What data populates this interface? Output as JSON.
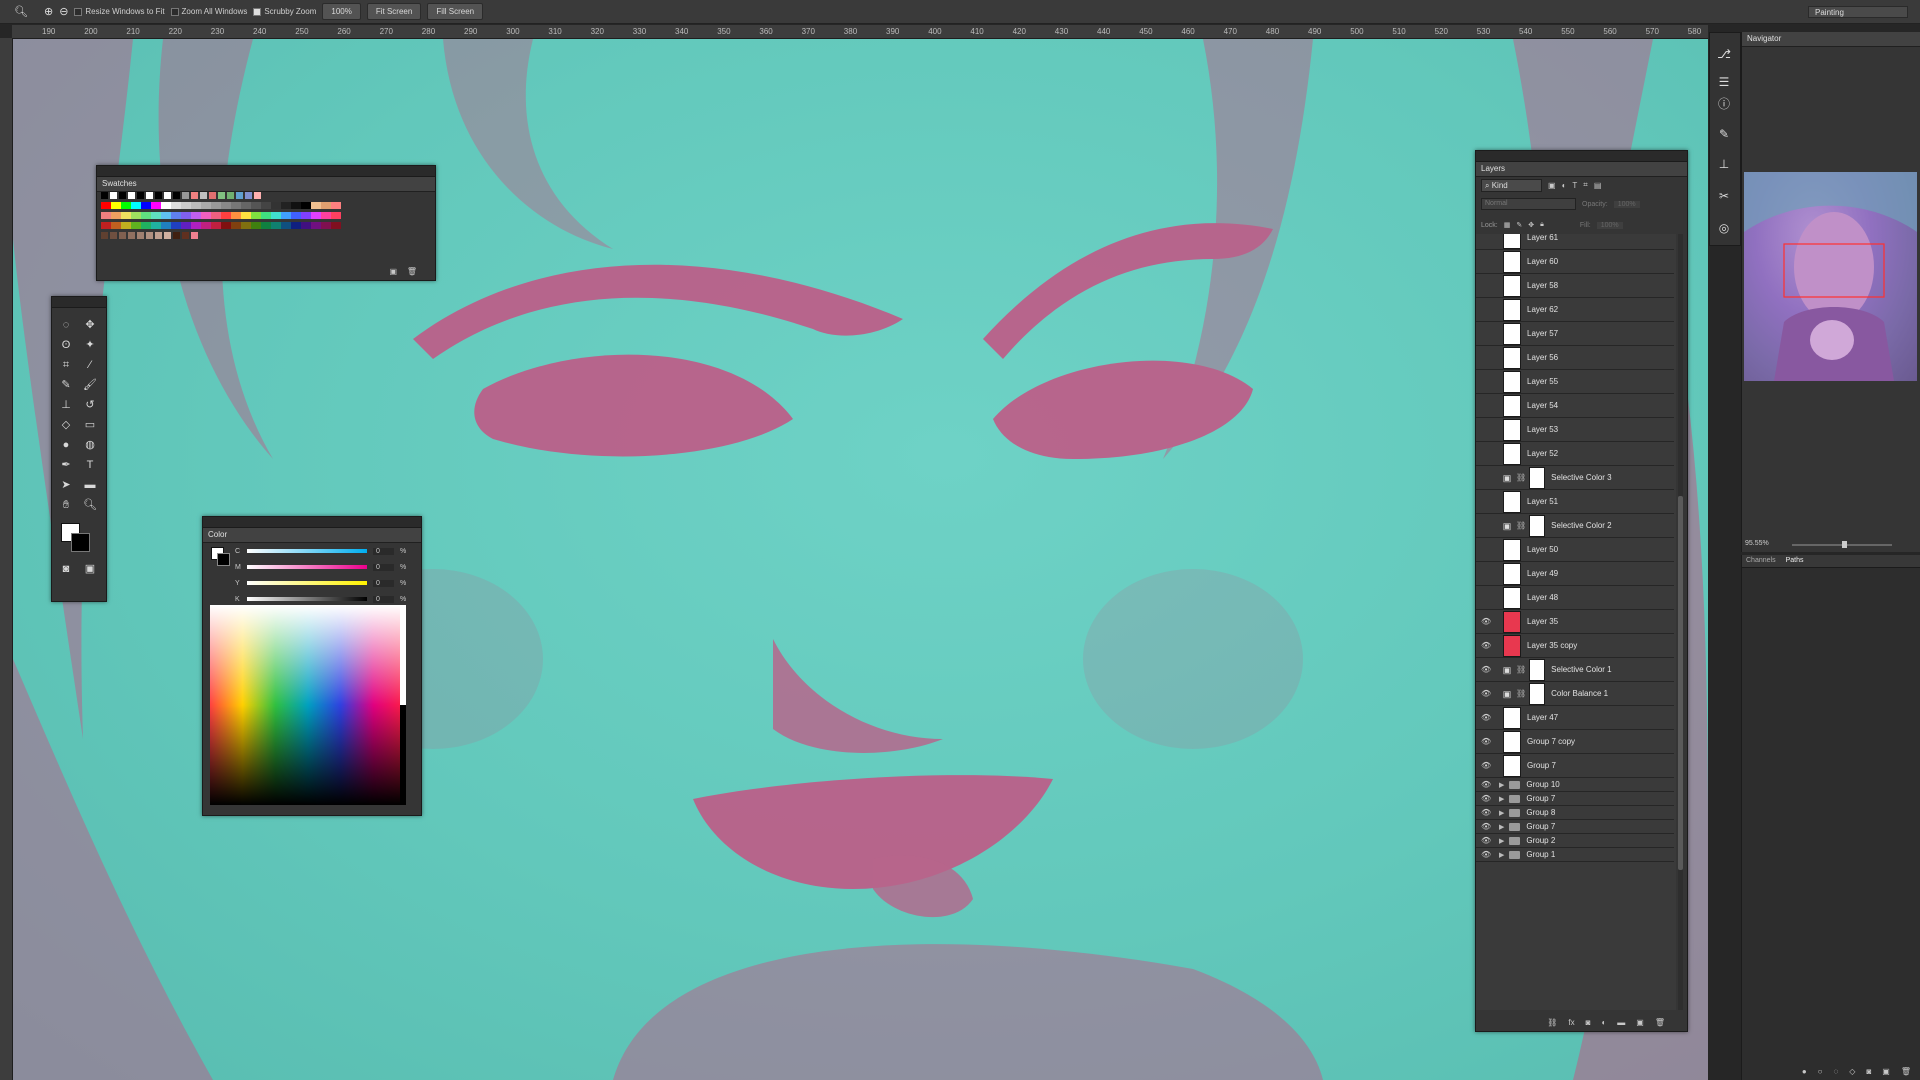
{
  "options_bar": {
    "resize_windows": "Resize Windows to Fit",
    "zoom_all": "Zoom All Windows",
    "scrubby_zoom": "Scrubby Zoom",
    "zoom_value": "100%",
    "fit_screen": "Fit Screen",
    "fill_screen": "Fill Screen",
    "workspace": "Painting"
  },
  "ruler": {
    "ticks": [
      "190",
      "200",
      "210",
      "220",
      "230",
      "240",
      "250",
      "260",
      "270",
      "280",
      "290",
      "300",
      "310",
      "320",
      "330",
      "340",
      "350",
      "360",
      "370",
      "380",
      "390",
      "400",
      "410",
      "420",
      "430",
      "440",
      "450",
      "460",
      "470",
      "480",
      "490",
      "500",
      "510",
      "520",
      "530",
      "540",
      "550",
      "560",
      "570",
      "580"
    ]
  },
  "swatches": {
    "title": "Swatches",
    "row0": [
      "#000000",
      "#ffffff",
      "#000000",
      "#ffffff",
      "#000000",
      "#ffffff",
      "#000000",
      "#ffffff",
      "#000000",
      "#999999",
      "#f08080",
      "#c0c0c0",
      "#e07070",
      "#80c080",
      "#70b070",
      "#60a0d0",
      "#8090d0",
      "#ffb0b0"
    ],
    "row1": [
      "#ff0000",
      "#ffff00",
      "#00ff00",
      "#00ffff",
      "#0000ff",
      "#ff00ff",
      "#ffffff",
      "#dddddd",
      "#cccccc",
      "#bbbbbb",
      "#aaaaaa",
      "#999999",
      "#888888",
      "#777777",
      "#666666",
      "#555555",
      "#444444",
      "#333333",
      "#222222",
      "#111111",
      "#000000",
      "#f0c090",
      "#e0a070",
      "#ff8080"
    ],
    "row2": [
      "#f08080",
      "#f0a060",
      "#f0e060",
      "#a0e060",
      "#60e080",
      "#60e0c0",
      "#60c0f0",
      "#6080f0",
      "#8060f0",
      "#c060f0",
      "#f060c0",
      "#f06080",
      "#ff4040",
      "#ff9040",
      "#ffe040",
      "#80e040",
      "#40e080",
      "#40e0d0",
      "#40a0ff",
      "#4060ff",
      "#8040ff",
      "#e040ff",
      "#ff40a0",
      "#ff4060"
    ],
    "row3": [
      "#c02020",
      "#c06020",
      "#c0b020",
      "#60b020",
      "#20b060",
      "#20b0a0",
      "#2080c0",
      "#2040c0",
      "#6020c0",
      "#b020c0",
      "#c02080",
      "#c02040",
      "#801010",
      "#804010",
      "#807010",
      "#408010",
      "#108040",
      "#108070",
      "#105080",
      "#102080",
      "#401080",
      "#701080",
      "#801050",
      "#801020"
    ],
    "row4": [
      "#604030",
      "#705040",
      "#806050",
      "#907060",
      "#a08070",
      "#b09080",
      "#c0a090",
      "#d0b0a0",
      "#402010",
      "#603020",
      "#f08090"
    ]
  },
  "color_panel": {
    "title": "Color",
    "sliders": [
      {
        "label": "C",
        "value": "0",
        "unit": "%"
      },
      {
        "label": "M",
        "value": "0",
        "unit": "%"
      },
      {
        "label": "Y",
        "value": "0",
        "unit": "%"
      },
      {
        "label": "K",
        "value": "0",
        "unit": "%"
      }
    ]
  },
  "layers_panel": {
    "title": "Layers",
    "filter": "Kind",
    "blend_mode": "Normal",
    "opacity_label": "Opacity:",
    "opacity_value": "100%",
    "lock_label": "Lock:",
    "fill_label": "Fill:",
    "fill_value": "100%",
    "layers": [
      {
        "name": "Layer 61",
        "visible": false,
        "kind": "layer"
      },
      {
        "name": "Layer 60",
        "visible": false,
        "kind": "layer"
      },
      {
        "name": "Layer 58",
        "visible": false,
        "kind": "layer"
      },
      {
        "name": "Layer 62",
        "visible": false,
        "kind": "layer"
      },
      {
        "name": "Layer 57",
        "visible": false,
        "kind": "layer"
      },
      {
        "name": "Layer 56",
        "visible": false,
        "kind": "layer"
      },
      {
        "name": "Layer 55",
        "visible": false,
        "kind": "layer"
      },
      {
        "name": "Layer 54",
        "visible": false,
        "kind": "layer"
      },
      {
        "name": "Layer 53",
        "visible": false,
        "kind": "layer"
      },
      {
        "name": "Layer 52",
        "visible": false,
        "kind": "layer"
      },
      {
        "name": "Selective Color 3",
        "visible": false,
        "kind": "adjustment"
      },
      {
        "name": "Layer 51",
        "visible": false,
        "kind": "layer"
      },
      {
        "name": "Selective Color 2",
        "visible": false,
        "kind": "adjustment"
      },
      {
        "name": "Layer 50",
        "visible": false,
        "kind": "layer"
      },
      {
        "name": "Layer 49",
        "visible": false,
        "kind": "layer"
      },
      {
        "name": "Layer 48",
        "visible": false,
        "kind": "layer"
      },
      {
        "name": "Layer 35",
        "visible": true,
        "kind": "layer",
        "color": "#e8384f"
      },
      {
        "name": "Layer 35 copy",
        "visible": true,
        "kind": "layer",
        "color": "#e8384f"
      },
      {
        "name": "Selective Color 1",
        "visible": true,
        "kind": "adjustment"
      },
      {
        "name": "Color Balance 1",
        "visible": true,
        "kind": "adjustment"
      },
      {
        "name": "Layer 47",
        "visible": true,
        "kind": "layer"
      },
      {
        "name": "Group 7 copy",
        "visible": true,
        "kind": "layer"
      },
      {
        "name": "Group 7",
        "visible": true,
        "kind": "layer"
      },
      {
        "name": "Group 10",
        "visible": true,
        "kind": "group"
      },
      {
        "name": "Group 7",
        "visible": true,
        "kind": "group"
      },
      {
        "name": "Group 8",
        "visible": true,
        "kind": "group"
      },
      {
        "name": "Group 7",
        "visible": true,
        "kind": "group"
      },
      {
        "name": "Group 2",
        "visible": true,
        "kind": "group"
      },
      {
        "name": "Group 1",
        "visible": true,
        "kind": "group"
      }
    ]
  },
  "navigator": {
    "title": "Navigator",
    "zoom": "95.55%"
  },
  "channels_panel": {
    "tabs": [
      "Channels",
      "Paths"
    ]
  },
  "colors": {
    "canvas_teal": "#62c8bb",
    "paint_pink": "#c05a86",
    "panel_bg": "#353535",
    "layer_red": "#e8384f"
  }
}
